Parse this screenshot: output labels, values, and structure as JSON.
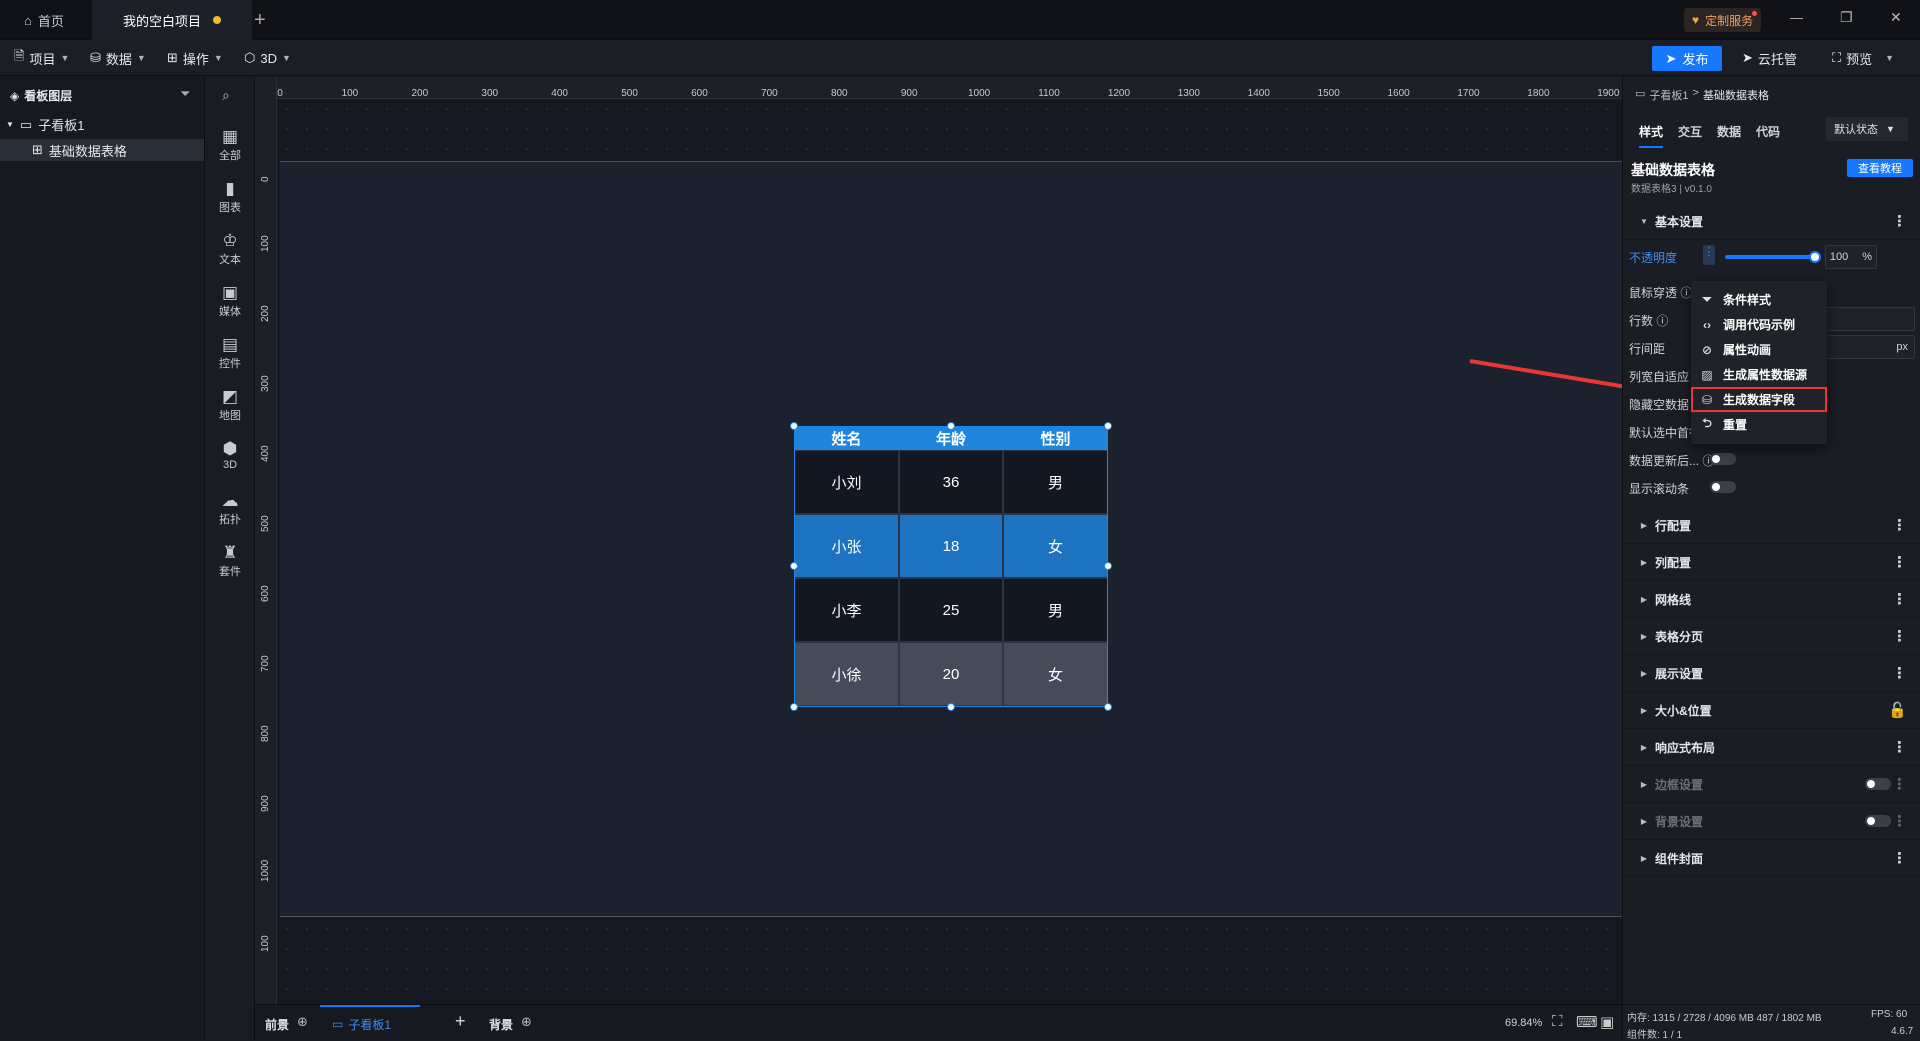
{
  "titlebar": {
    "home_label": "首页",
    "project_tab": "我的空白项目",
    "new_tab": "+",
    "service_label": "定制服务",
    "minimize": "—",
    "restore": "❐",
    "close": "✕"
  },
  "toolbar": {
    "project": "项目",
    "data": "数据",
    "operate": "操作",
    "three_d": "3D",
    "publish": "发布",
    "cloud": "云托管",
    "preview": "预览"
  },
  "layers": {
    "title": "看板图层",
    "board": "子看板1",
    "item": "基础数据表格"
  },
  "components": [
    "全部",
    "图表",
    "文本",
    "媒体",
    "控件",
    "地图",
    "3D",
    "拓扑",
    "套件"
  ],
  "rulers": {
    "top": [
      "0",
      "100",
      "200",
      "300",
      "400",
      "500",
      "600",
      "700",
      "800",
      "900",
      "1000",
      "1100",
      "1200",
      "1300",
      "1400",
      "1500",
      "1600",
      "1700",
      "1800",
      "1900"
    ],
    "left": [
      "0",
      "100",
      "200",
      "300",
      "400",
      "500",
      "600",
      "700",
      "800",
      "900",
      "1000",
      "100",
      "00"
    ]
  },
  "table": {
    "headers": [
      "姓名",
      "年龄",
      "性别"
    ],
    "rows": [
      [
        "小刘",
        "36",
        "男"
      ],
      [
        "小张",
        "18",
        "女"
      ],
      [
        "小李",
        "25",
        "男"
      ],
      [
        "小徐",
        "20",
        "女"
      ]
    ],
    "colors": {
      "header": "#1f85dc",
      "row_dark": "#121722",
      "row_blue": "#1e73c0",
      "row_gray": "#454b59"
    }
  },
  "bottom": {
    "foreground": "前景",
    "board_tab": "子看板1",
    "add": "+",
    "background": "背景",
    "zoom": "69.84%"
  },
  "panel": {
    "breadcrumb_parent": "子看板1",
    "breadcrumb_sep": ">",
    "breadcrumb_current": "基础数据表格",
    "tabs": [
      "样式",
      "交互",
      "数据",
      "代码"
    ],
    "state": "默认状态",
    "component_name": "基础数据表格",
    "component_version": "数据表格3 | v0.1.0",
    "tutorial": "查看教程",
    "basic_settings": "基本设置",
    "opacity_label": "不透明度",
    "opacity_value": "100",
    "opacity_unit": "%",
    "opacity_level": 100,
    "props": [
      "鼠标穿透",
      "行数",
      "行间距",
      "列宽自适应",
      "隐藏空数据",
      "默认选中首行",
      "数据更新后...",
      "显示滚动条"
    ],
    "px_unit": "px",
    "sections": [
      "行配置",
      "列配置",
      "网格线",
      "表格分页",
      "展示设置",
      "大小&位置",
      "响应式布局",
      "边框设置",
      "背景设置",
      "组件封面"
    ]
  },
  "context_menu": {
    "items": [
      "条件样式",
      "调用代码示例",
      "属性动画",
      "生成属性数据源",
      "生成数据字段",
      "重置"
    ],
    "highlight": "生成数据字段",
    "highlight_color": "#e53935"
  },
  "status": {
    "memory": "内存: 1315 / 2728 / 4096 MB  487 / 1802 MB",
    "fps": "FPS: 60",
    "count": "组件数: 1 / 1",
    "version": "4.6.7"
  }
}
